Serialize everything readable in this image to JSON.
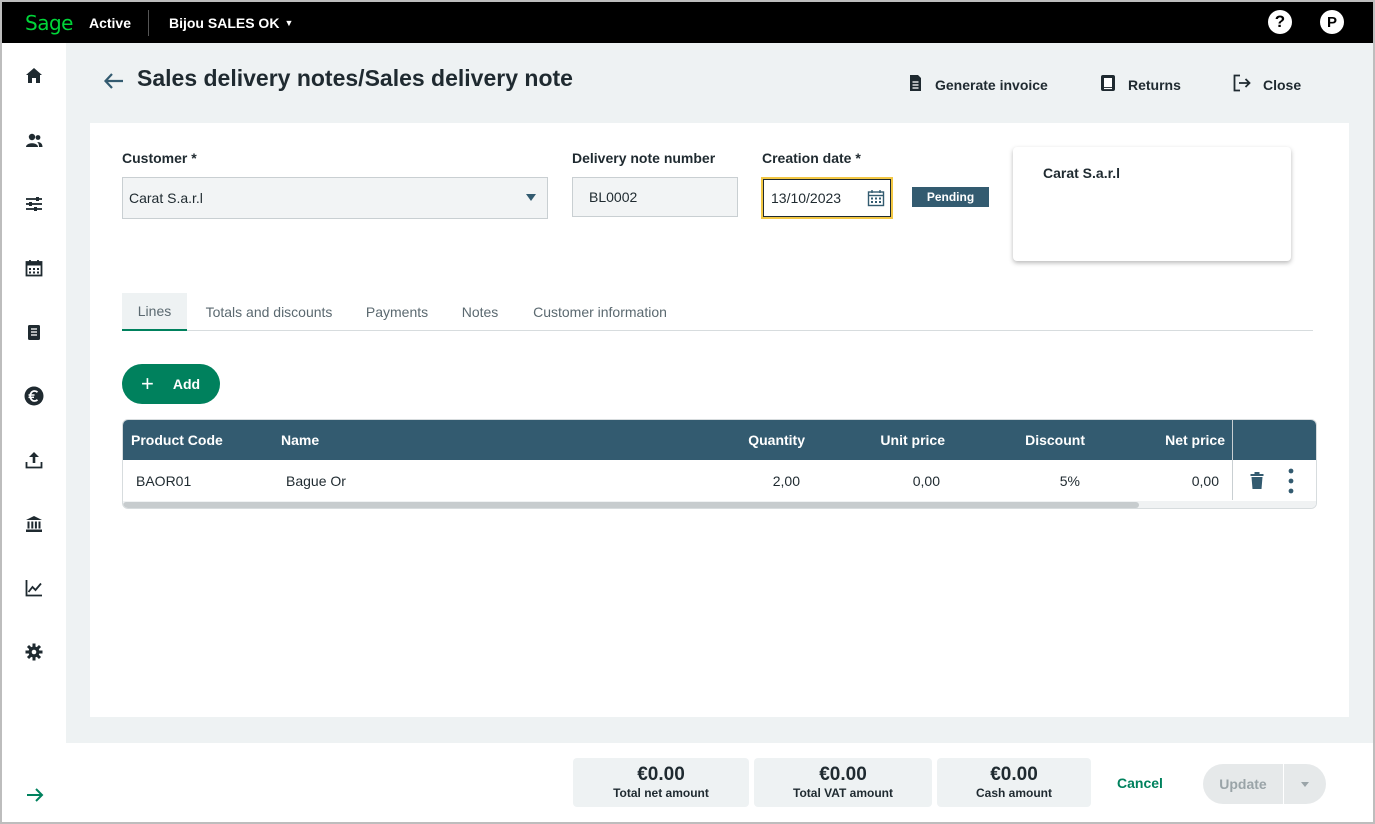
{
  "topbar": {
    "logo": "Sage",
    "environment": "Active",
    "company": "Bijou SALES OK",
    "help_label": "?",
    "profile_initial": "P"
  },
  "sidebar": {
    "items": [
      {
        "icon": "home-icon"
      },
      {
        "icon": "contacts-icon"
      },
      {
        "icon": "settings-sliders-icon"
      },
      {
        "icon": "calendar-icon"
      },
      {
        "icon": "document-icon"
      },
      {
        "icon": "euro-icon"
      },
      {
        "icon": "upload-icon"
      },
      {
        "icon": "bank-icon"
      },
      {
        "icon": "chart-line-icon"
      },
      {
        "icon": "gear-icon"
      }
    ],
    "expand_icon": "arrow-right-icon"
  },
  "header": {
    "title": "Sales delivery notes/Sales delivery note",
    "generate_invoice": "Generate invoice",
    "returns": "Returns",
    "close": "Close"
  },
  "form": {
    "customer_label": "Customer *",
    "customer_value": "Carat S.a.r.l",
    "delivery_note_label": "Delivery note number",
    "delivery_note_value": "BL0002",
    "creation_date_label": "Creation date *",
    "creation_date_value": "13/10/2023",
    "status": "Pending",
    "customer_card": "Carat S.a.r.l"
  },
  "tabs": [
    {
      "label": "Lines",
      "active": true
    },
    {
      "label": "Totals and discounts",
      "active": false
    },
    {
      "label": "Payments",
      "active": false
    },
    {
      "label": "Notes",
      "active": false
    },
    {
      "label": "Customer information",
      "active": false
    }
  ],
  "add_button": "Add",
  "table": {
    "columns": [
      "Product Code",
      "Name",
      "Quantity",
      "Unit price",
      "Discount",
      "Net price"
    ],
    "rows": [
      [
        "BAOR01",
        "Bague Or",
        "2,00",
        "0,00",
        "5%",
        "0,00"
      ]
    ]
  },
  "totals": [
    {
      "amount": "€0.00",
      "caption": "Total net amount"
    },
    {
      "amount": "€0.00",
      "caption": "Total VAT amount"
    },
    {
      "amount": "€0.00",
      "caption": "Cash amount"
    }
  ],
  "actions": {
    "cancel": "Cancel",
    "update": "Update"
  },
  "colors": {
    "primary": "#00815d",
    "header": "#335b70",
    "background": "#eef2f3",
    "focus": "#f2c744"
  }
}
